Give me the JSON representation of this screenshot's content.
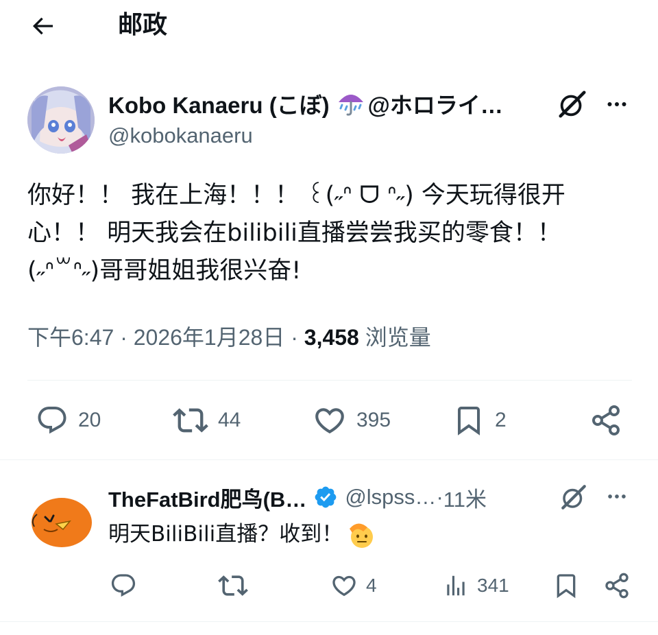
{
  "header": {
    "title": "邮政"
  },
  "tweet": {
    "author_name": "Kobo Kanaeru (こぼ)",
    "author_name_suffix": "@ホロライ…",
    "author_handle": "@kobokanaeru",
    "text_lines": [
      "你好！！ 我在上海！！！ ꒰(˶ᐢ ᗜ ᐢ˶) 今天玩得很开",
      "心！！ 明天我会在bilibili直播尝尝我买的零食！！",
      "(˶ᐢ꒳ᐢ˶)哥哥姐姐我很兴奋!"
    ],
    "time": "下午6:47",
    "separator1": " · ",
    "date": "2026年1月28日",
    "separator2": " · ",
    "views_count": "3,458",
    "views_label": " 浏览量",
    "actions": {
      "replies": "20",
      "retweets": "44",
      "likes": "395",
      "bookmarks": "2"
    }
  },
  "reply": {
    "author_name": "TheFatBird肥鸟(B…",
    "author_handle": "@lspss…",
    "separator": " · ",
    "time": "11米",
    "text": "明天BiliBili直播？收到！",
    "actions": {
      "likes": "4",
      "views": "341"
    }
  },
  "icons": {
    "back": "arrow-left-icon",
    "grok": "grok-icon",
    "more": "more-horizontal-icon",
    "reply": "comment-icon",
    "retweet": "retweet-icon",
    "like": "heart-icon",
    "bookmark": "bookmark-icon",
    "share": "share-icon",
    "views": "analytics-icon",
    "verified": "verified-badge-icon"
  },
  "colors": {
    "text": "#0f1419",
    "secondary": "#536471",
    "divider": "#eff3f4",
    "verified": "#1d9bf0"
  }
}
